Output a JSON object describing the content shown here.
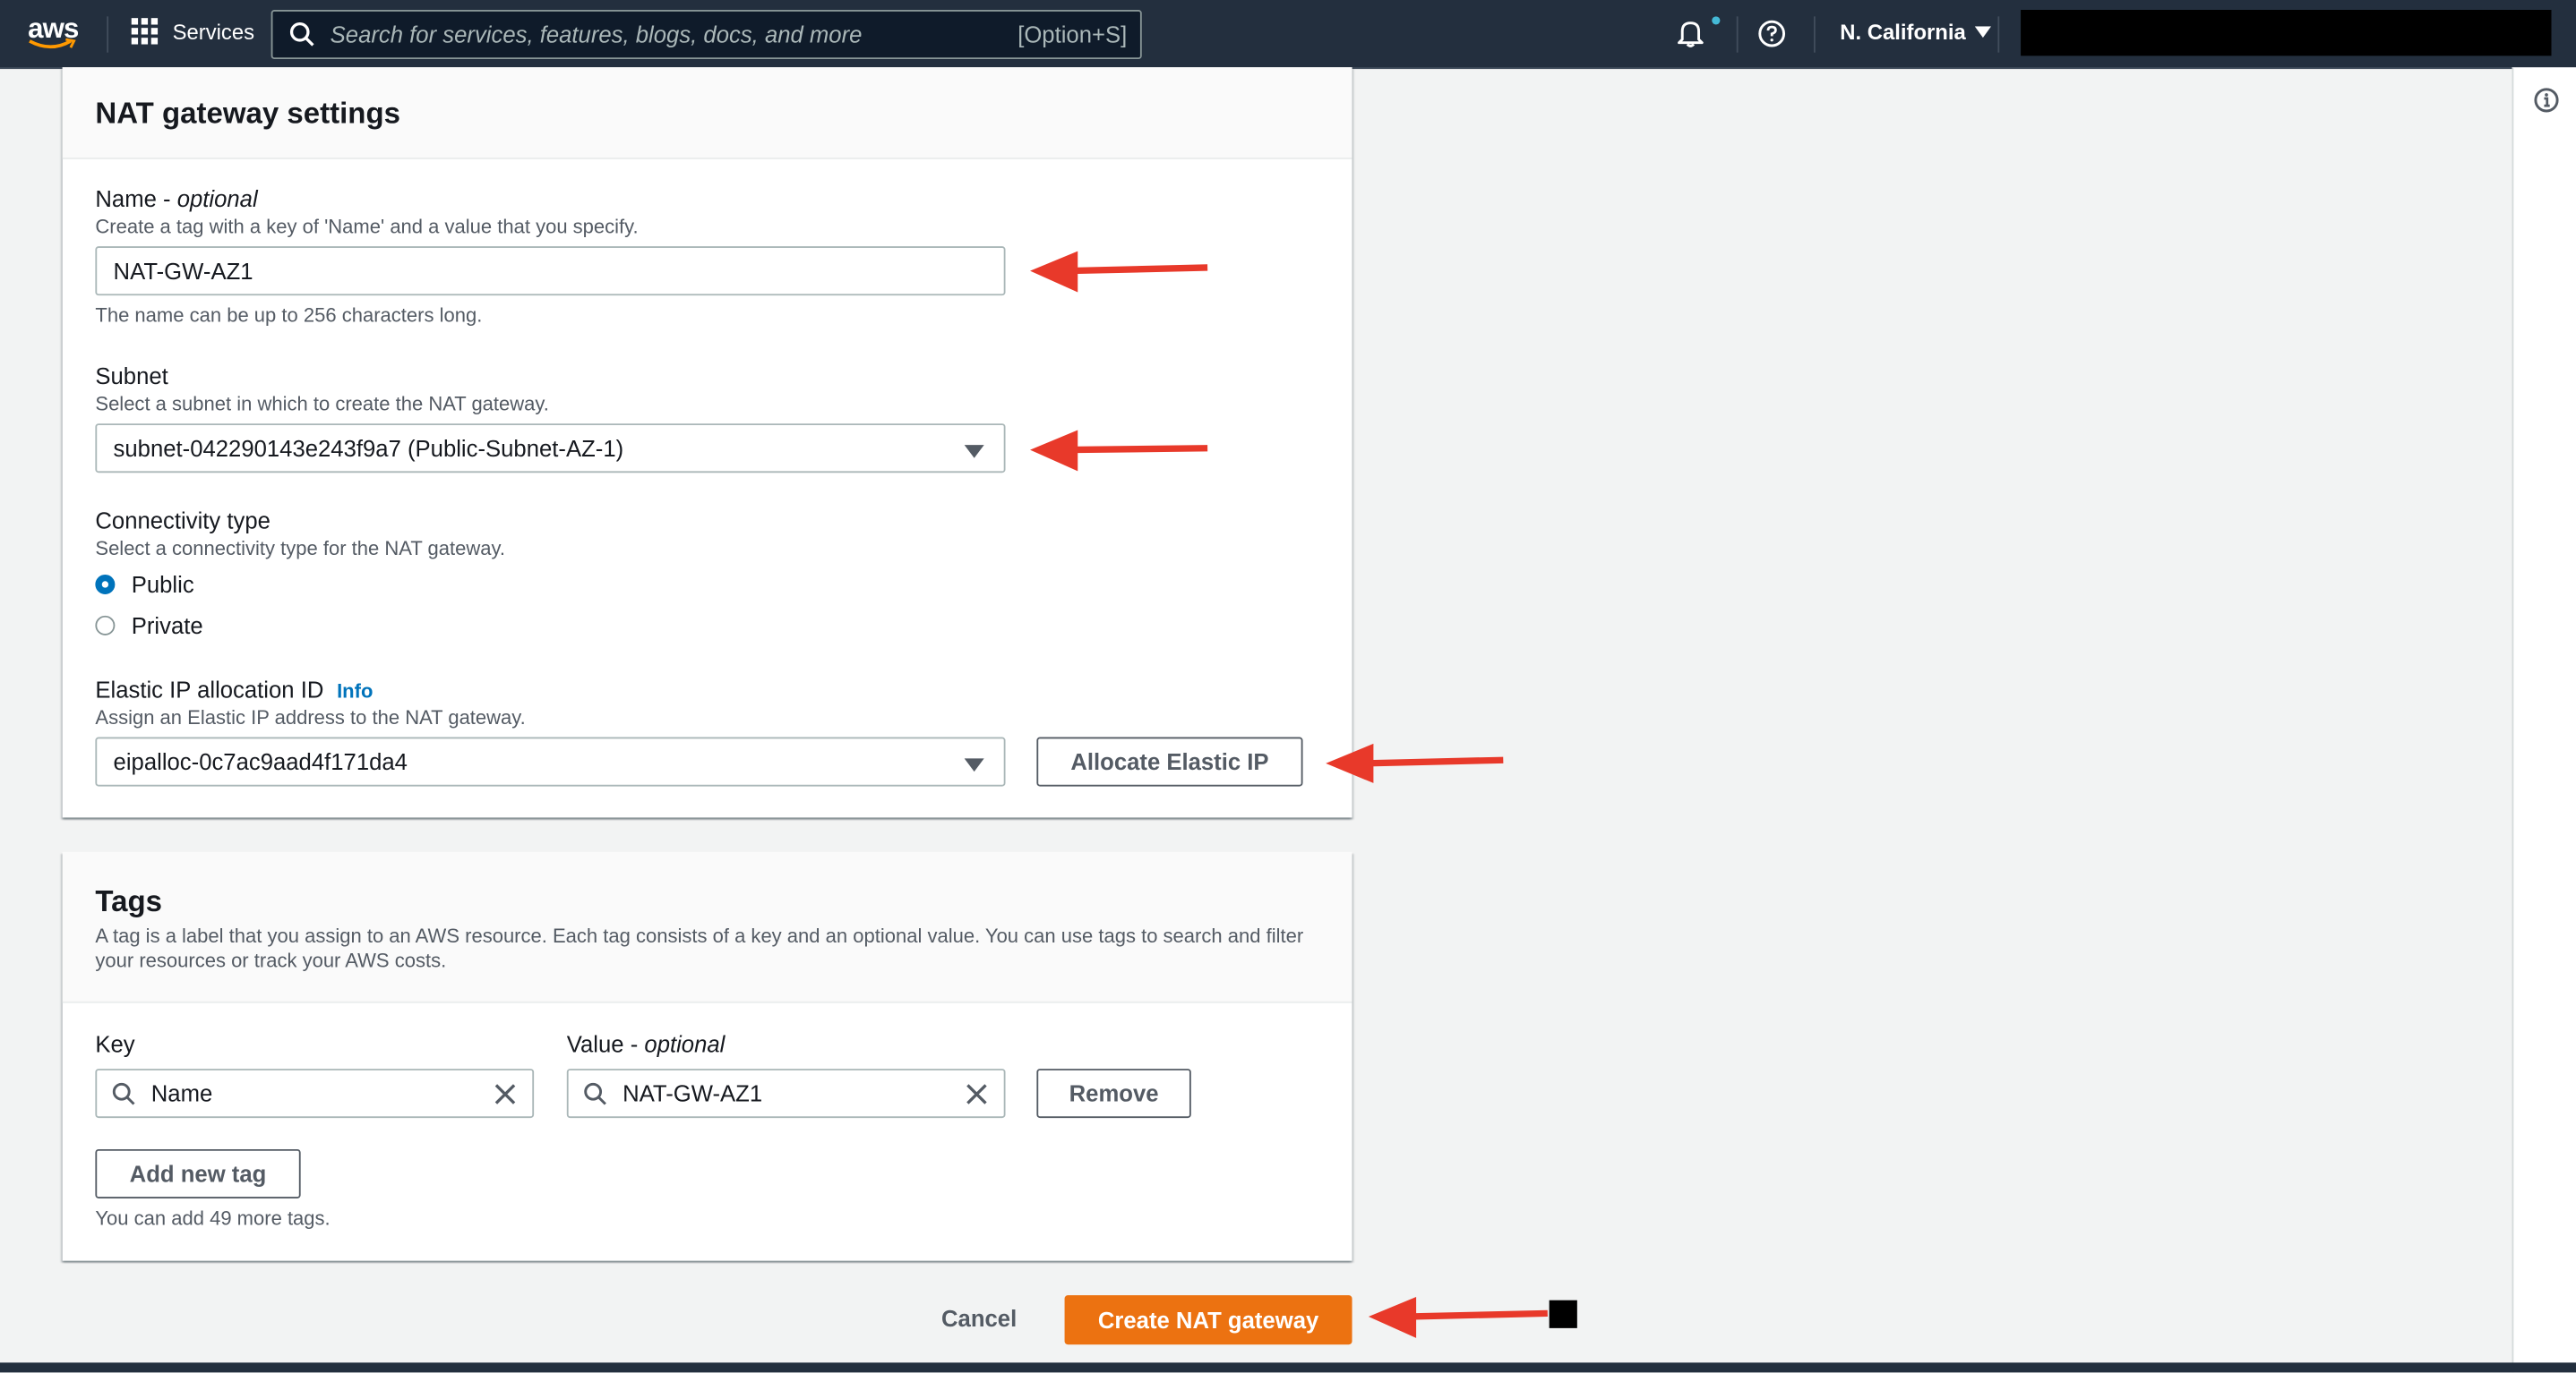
{
  "topbar": {
    "logo_text": "aws",
    "services_label": "Services",
    "search_placeholder": "Search for services, features, blogs, docs, and more",
    "search_shortcut": "[Option+S]",
    "region": "N. California"
  },
  "nat_settings": {
    "title": "NAT gateway settings",
    "name_label_main": "Name - ",
    "name_label_optional": "optional",
    "name_desc": "Create a tag with a key of 'Name' and a value that you specify.",
    "name_value": "NAT-GW-AZ1",
    "name_hint": "The name can be up to 256 characters long.",
    "subnet_label": "Subnet",
    "subnet_desc": "Select a subnet in which to create the NAT gateway.",
    "subnet_value": "subnet-042290143e243f9a7 (Public-Subnet-AZ-1)",
    "conn_label": "Connectivity type",
    "conn_desc": "Select a connectivity type for the NAT gateway.",
    "conn_options": [
      "Public",
      "Private"
    ],
    "conn_selected": "Public",
    "eip_label": "Elastic IP allocation ID",
    "eip_info": "Info",
    "eip_desc": "Assign an Elastic IP address to the NAT gateway.",
    "eip_value": "eipalloc-0c7ac9aad4f171da4",
    "allocate_button": "Allocate Elastic IP"
  },
  "tags": {
    "title": "Tags",
    "desc": "A tag is a label that you assign to an AWS resource. Each tag consists of a key and an optional value. You can use tags to search and filter your resources or track your AWS costs.",
    "key_label": "Key",
    "value_label_main": "Value - ",
    "value_label_optional": "optional",
    "key_value": "Name",
    "value_value": "NAT-GW-AZ1",
    "remove_button": "Remove",
    "add_button": "Add new tag",
    "hint": "You can add 49 more tags."
  },
  "footer": {
    "cancel": "Cancel",
    "create": "Create NAT gateway"
  },
  "colors": {
    "topbar": "#232f3e",
    "primary": "#ec7211",
    "link": "#0073bb",
    "annotation_arrow": "#e8392a"
  }
}
